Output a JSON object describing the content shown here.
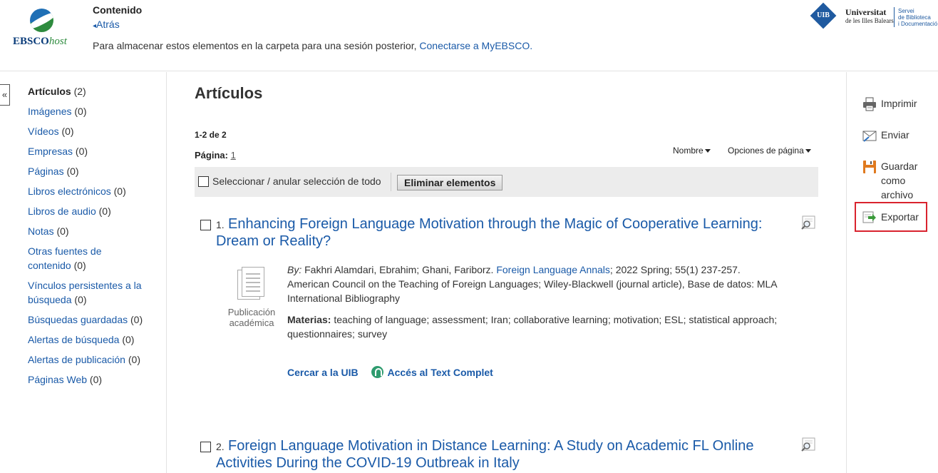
{
  "header": {
    "brand": "EBSCO",
    "brand_suffix": "host",
    "section_title": "Contenido",
    "back_label": "Atrás",
    "storage_message": "Para almacenar estos elementos en la carpeta para una sesión posterior,",
    "storage_link": "Conectarse a MyEBSCO.",
    "uib": {
      "badge": "UIB",
      "name": "Universitat",
      "name_sub": "de les Illes Balears",
      "service_line1": "Servei",
      "service_line2": "de Biblioteca",
      "service_line3": "i Documentació"
    }
  },
  "collapse_label": "«",
  "leftnav": {
    "items": [
      {
        "label": "Artículos",
        "count": "(2)",
        "active": true
      },
      {
        "label": "Imágenes",
        "count": "(0)"
      },
      {
        "label": "Vídeos",
        "count": "(0)"
      },
      {
        "label": "Empresas",
        "count": "(0)"
      },
      {
        "label": "Páginas",
        "count": "(0)"
      },
      {
        "label": "Libros electrónicos",
        "count": "(0)"
      },
      {
        "label": "Libros de audio",
        "count": "(0)"
      },
      {
        "label": "Notas",
        "count": "(0)"
      },
      {
        "label": "Otras fuentes de contenido",
        "count": "(0)"
      },
      {
        "label": "Vínculos persistentes a la búsqueda",
        "count": "(0)"
      },
      {
        "label": "Búsquedas guardadas",
        "count": "(0)"
      },
      {
        "label": "Alertas de búsqueda",
        "count": "(0)"
      },
      {
        "label": "Alertas de publicación",
        "count": "(0)"
      },
      {
        "label": "Páginas Web",
        "count": "(0)"
      }
    ]
  },
  "main": {
    "title": "Artículos",
    "range": "1-2 de 2",
    "page_label": "Página:",
    "page_number": "1",
    "sort_label": "Nombre",
    "page_options_label": "Opciones de página",
    "select_all_label": "Seleccionar / anular selección de todo",
    "delete_button": "Eliminar elementos"
  },
  "results": [
    {
      "number": "1.",
      "title": "Enhancing Foreign Language Motivation through the Magic of Cooperative Learning: Dream or Reality?",
      "pub_type": "Publicación académica",
      "by_label": "By:",
      "authors": "Fakhri Alamdari, Ebrahim; Ghani, Fariborz.",
      "journal": "Foreign Language Annals",
      "citation": "; 2022 Spring; 55(1) 237-257. American Council on the Teaching of Foreign Languages; Wiley-Blackwell (journal article), Base de datos: MLA International Bibliography",
      "subjects_label": "Materias:",
      "subjects": "teaching of language; assessment; Iran; collaborative learning; motivation; ESL; statistical approach; questionnaires; survey",
      "link_uib": "Cercar a la UIB",
      "link_fulltext": "Accés al Text Complet"
    },
    {
      "number": "2.",
      "title": "Foreign Language Motivation in Distance Learning: A Study on Academic FL Online Activities During the COVID-19 Outbreak in Italy"
    }
  ],
  "tools": {
    "print": "Imprimir",
    "send": "Enviar",
    "save": "Guardar como archivo",
    "export": "Exportar"
  },
  "colors": {
    "link": "#1a5aa8",
    "export_highlight": "#d9232e"
  }
}
